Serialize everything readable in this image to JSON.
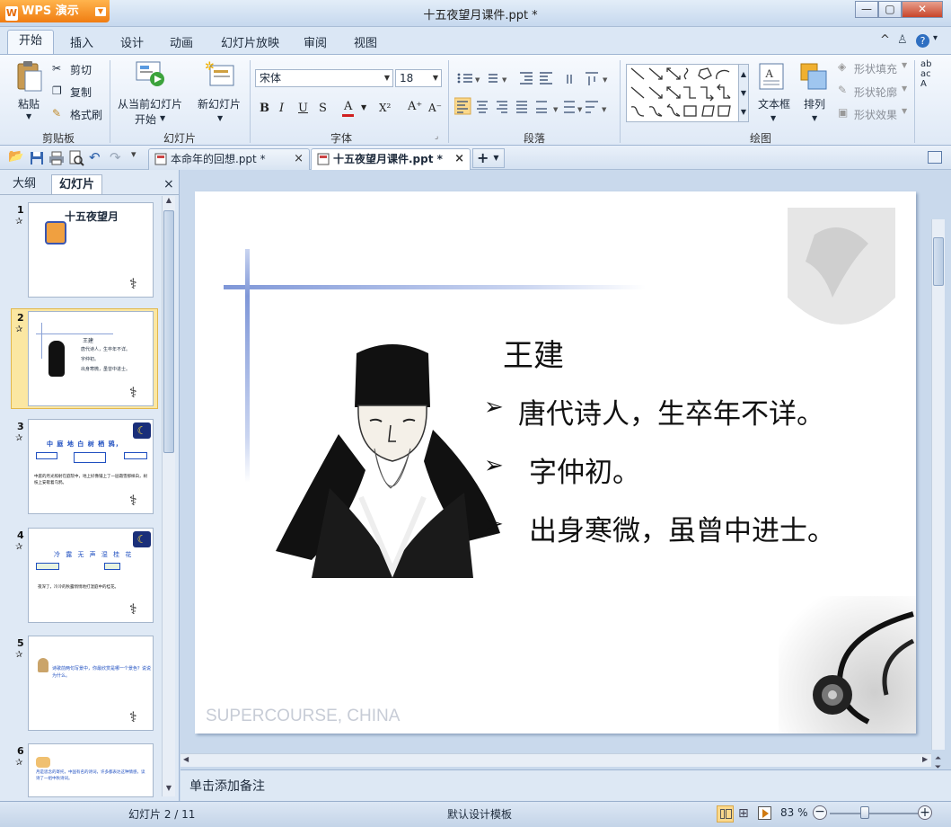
{
  "app": {
    "name": "WPS 演示",
    "logo_letter": "W"
  },
  "window": {
    "title": "十五夜望月课件.ppt *",
    "min": "—",
    "max": "▢",
    "close": "✕"
  },
  "ribbon_tabs": [
    "开始",
    "插入",
    "设计",
    "动画",
    "幻灯片放映",
    "审阅",
    "视图"
  ],
  "help_icons": [
    "^",
    "?",
    "?",
    "▾"
  ],
  "clipboard": {
    "paste": "粘贴",
    "cut": "剪切",
    "copy": "复制",
    "format_painter": "格式刷",
    "group": "剪贴板"
  },
  "slides_group": {
    "from_current_1": "从当前幻灯片",
    "from_current_2": "开始",
    "new_slide": "新幻灯片",
    "group": "幻灯片"
  },
  "font": {
    "name": "宋体",
    "size": "18",
    "group": "字体",
    "bold": "B",
    "italic": "I",
    "underline": "U",
    "shadow": "S",
    "color": "A",
    "superscript": "X²",
    "grow": "A⁺",
    "shrink": "A⁻"
  },
  "paragraph": {
    "group": "段落"
  },
  "drawing": {
    "textbox": "文本框",
    "arrange": "排列",
    "shape_fill": "形状填充",
    "shape_outline": "形状轮廓",
    "shape_effect": "形状效果",
    "group": "绘图"
  },
  "quick_access": {
    "customize": "▾"
  },
  "doc_tabs": [
    {
      "label": "本命年的回想.ppt *",
      "close": "×"
    },
    {
      "label": "十五夜望月课件.ppt *",
      "close": "×"
    }
  ],
  "new_tab": "+",
  "left_pane": {
    "tabs": [
      "大纲",
      "幻灯片"
    ],
    "close": "×"
  },
  "thumbnails": [
    {
      "num": "1",
      "title": "十五夜望月"
    },
    {
      "num": "2",
      "title": "王建",
      "lines": [
        "唐代诗人，生卒年不详。",
        "字仲初。",
        "出身寒微，虽曾中进士。"
      ]
    },
    {
      "num": "3",
      "title": "中 庭 地 白 树 栖 鸦，",
      "text": "中庭的月光照射在庭院中，地上好像铺上了一层霜雪那样白，树枝上安歇着乌鸦。"
    },
    {
      "num": "4",
      "title": "冷 露 无 声 湿 桂 花",
      "text": "夜深了，冷冷的秋露悄悄地打湿庭中的桂花。"
    },
    {
      "num": "5",
      "text": "诗歌前两句写景中，你最欣赏是哪一个景色？说说为什么。"
    },
    {
      "num": "6",
      "text": "月是思念的寄托，中国有名的诗词，许多都表达这种情感，读诗了一组中秋诗词。"
    }
  ],
  "slide": {
    "title": "王建",
    "bullets": [
      "唐代诗人，生卒年不详。",
      "字仲初。",
      "出身寒微，虽曾中进士。"
    ],
    "watermark": "SUPERCOURSE, CHINA"
  },
  "notes": {
    "placeholder": "单击添加备注"
  },
  "status": {
    "slide_pos": "幻灯片 2 / 11",
    "template": "默认设计模板",
    "zoom": "83 %",
    "zoom_level": 0.83
  }
}
